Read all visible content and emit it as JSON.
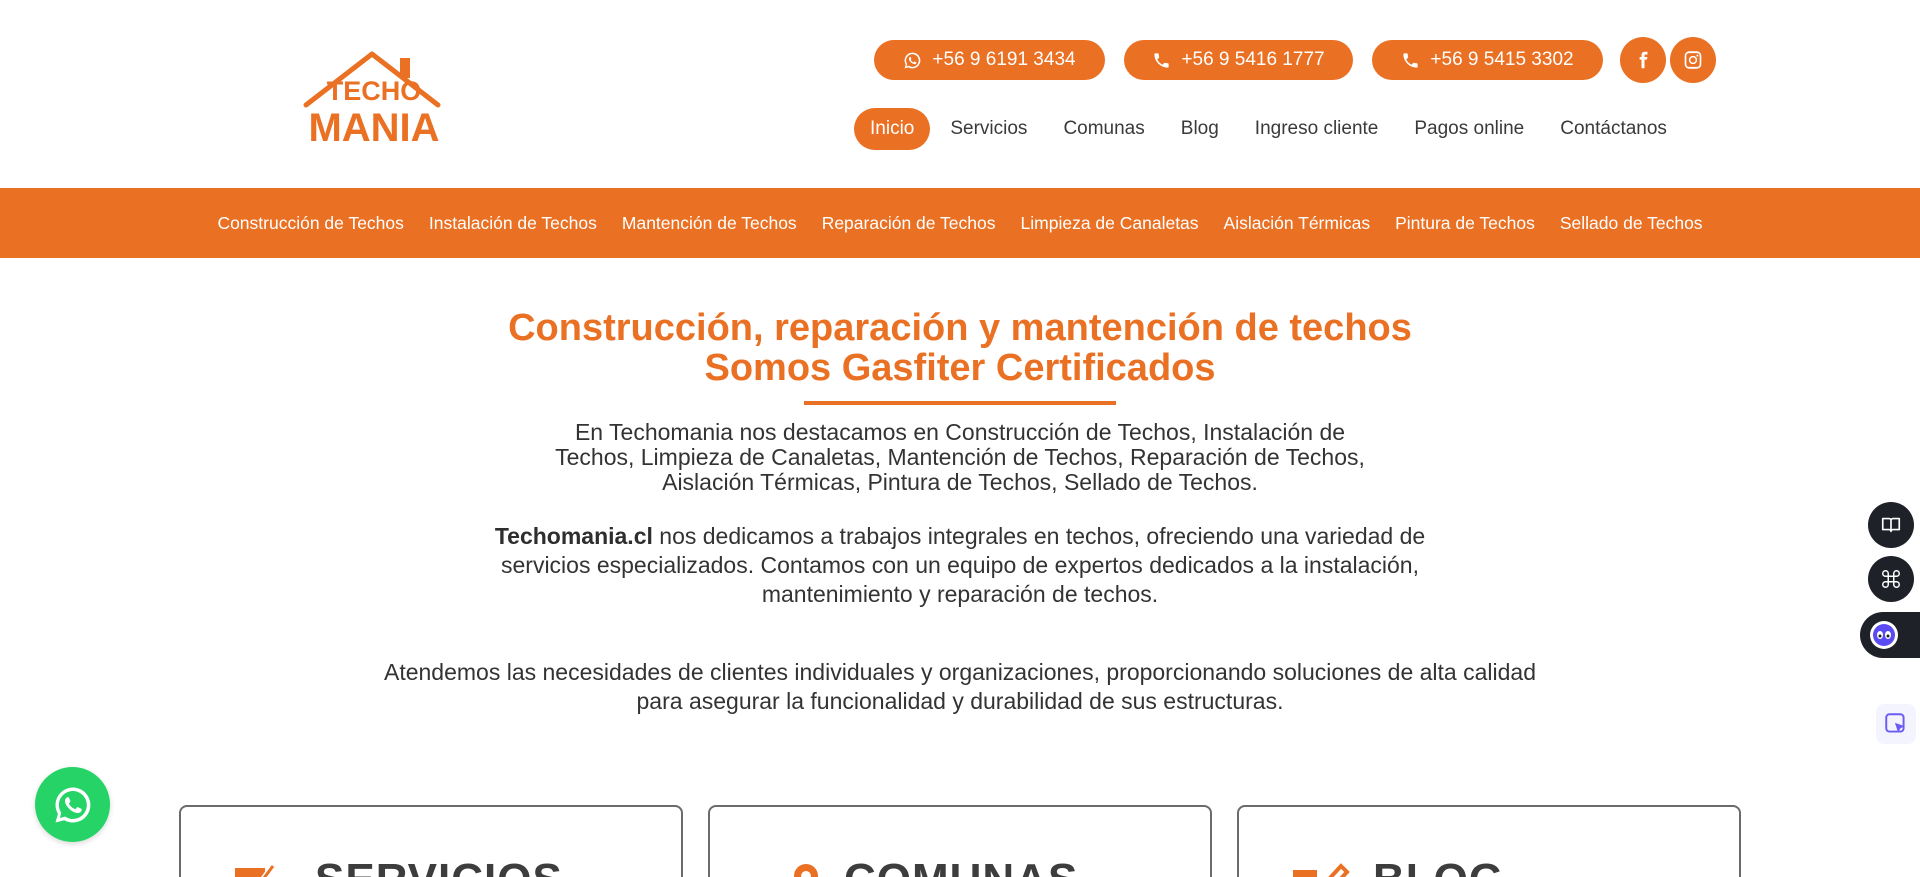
{
  "header": {
    "logo": {
      "line1": "TECHO",
      "line2": "MANIA"
    },
    "phones": [
      {
        "label": "+56 9 6191 3434",
        "icon": "whatsapp-icon"
      },
      {
        "label": "+56 9 5416 1777",
        "icon": "phone-icon"
      },
      {
        "label": "+56 9 5415 3302",
        "icon": "phone-icon"
      }
    ],
    "social": [
      "facebook-icon",
      "instagram-icon"
    ],
    "nav": [
      "Inicio",
      "Servicios",
      "Comunas",
      "Blog",
      "Ingreso cliente",
      "Pagos online",
      "Contáctanos"
    ],
    "active_nav": "Inicio"
  },
  "service_bar": [
    "Construcción de Techos",
    "Instalación de Techos",
    "Mantención de Techos",
    "Reparación de Techos",
    "Limpieza de Canaletas",
    "Aislación Térmicas",
    "Pintura de Techos",
    "Sellado de Techos"
  ],
  "main": {
    "title_line1": "Construcción, reparación y mantención de techos",
    "title_line2": "Somos Gasfiter Certificados",
    "paragraph1": "En Techomania nos destacamos en Construcción de Techos, Instalación de Techos, Limpieza de Canaletas, Mantención de Techos, Reparación de Techos, Aislación Térmicas, Pintura de Techos, Sellado de Techos.",
    "paragraph2_bold": "Techomania.cl",
    "paragraph2_rest": " nos dedicamos a trabajos integrales en techos, ofreciendo una variedad de servicios especializados. Contamos con un equipo de expertos dedicados a la instalación, mantenimiento y reparación de techos.",
    "paragraph3": "Atendemos las necesidades de clientes individuales y organizaciones, proporcionando soluciones de alta calidad para asegurar la funcionalidad y durabilidad de sus estructuras."
  },
  "cards": [
    {
      "title": "SERVICIOS",
      "icon": "edit-icon"
    },
    {
      "title": "COMUNAS",
      "icon": "location-icon"
    },
    {
      "title": "BLOG",
      "icon": "write-icon"
    }
  ],
  "colors": {
    "brand": "#ea7023",
    "whatsapp": "#25d366",
    "dark_tool": "#1e2228"
  }
}
